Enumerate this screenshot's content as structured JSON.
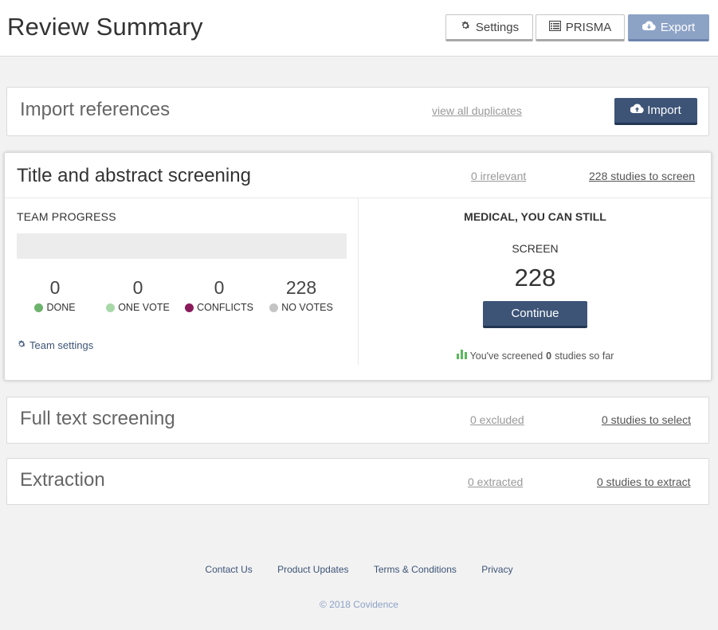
{
  "header": {
    "title": "Review Summary",
    "settings_label": "Settings",
    "prisma_label": "PRISMA",
    "export_label": "Export"
  },
  "import": {
    "title": "Import references",
    "duplicates_link": "view all duplicates",
    "import_label": "Import"
  },
  "screening": {
    "title": "Title and abstract screening",
    "irrelevant_link": "0 irrelevant",
    "to_screen_link": "228 studies to screen",
    "team_progress_label": "TEAM PROGRESS",
    "progress_fraction": 0,
    "stats": [
      {
        "value": "0",
        "label": "DONE",
        "color": "#6db36d"
      },
      {
        "value": "0",
        "label": "ONE VOTE",
        "color": "#a8d8a8"
      },
      {
        "value": "0",
        "label": "CONFLICTS",
        "color": "#8a1a5c"
      },
      {
        "value": "228",
        "label": "NO VOTES",
        "color": "#c4c4c4"
      }
    ],
    "team_settings_label": "Team settings",
    "user_message": "MEDICAL, YOU CAN STILL",
    "screen_label": "SCREEN",
    "screen_count": "228",
    "continue_label": "Continue",
    "screened_prefix": "You've screened",
    "screened_count": "0",
    "screened_suffix": "studies so far"
  },
  "full_text": {
    "title": "Full text screening",
    "excluded_link": "0 excluded",
    "to_select_link": "0 studies to select"
  },
  "extraction": {
    "title": "Extraction",
    "extracted_link": "0 extracted",
    "to_extract_link": "0 studies to extract"
  },
  "footer": {
    "links": [
      "Contact Us",
      "Product Updates",
      "Terms & Conditions",
      "Privacy"
    ],
    "copyright": "© 2018 Covidence"
  },
  "icons": {
    "settings": "gear-icon",
    "prisma": "list-icon",
    "export": "cloud-download-icon",
    "import": "cloud-upload-icon",
    "team_settings": "gear-icon",
    "screened": "bar-chart-icon"
  },
  "colors": {
    "primary": "#3d5477",
    "export": "#8da3c6",
    "chart_icon": "#5cb85c"
  }
}
